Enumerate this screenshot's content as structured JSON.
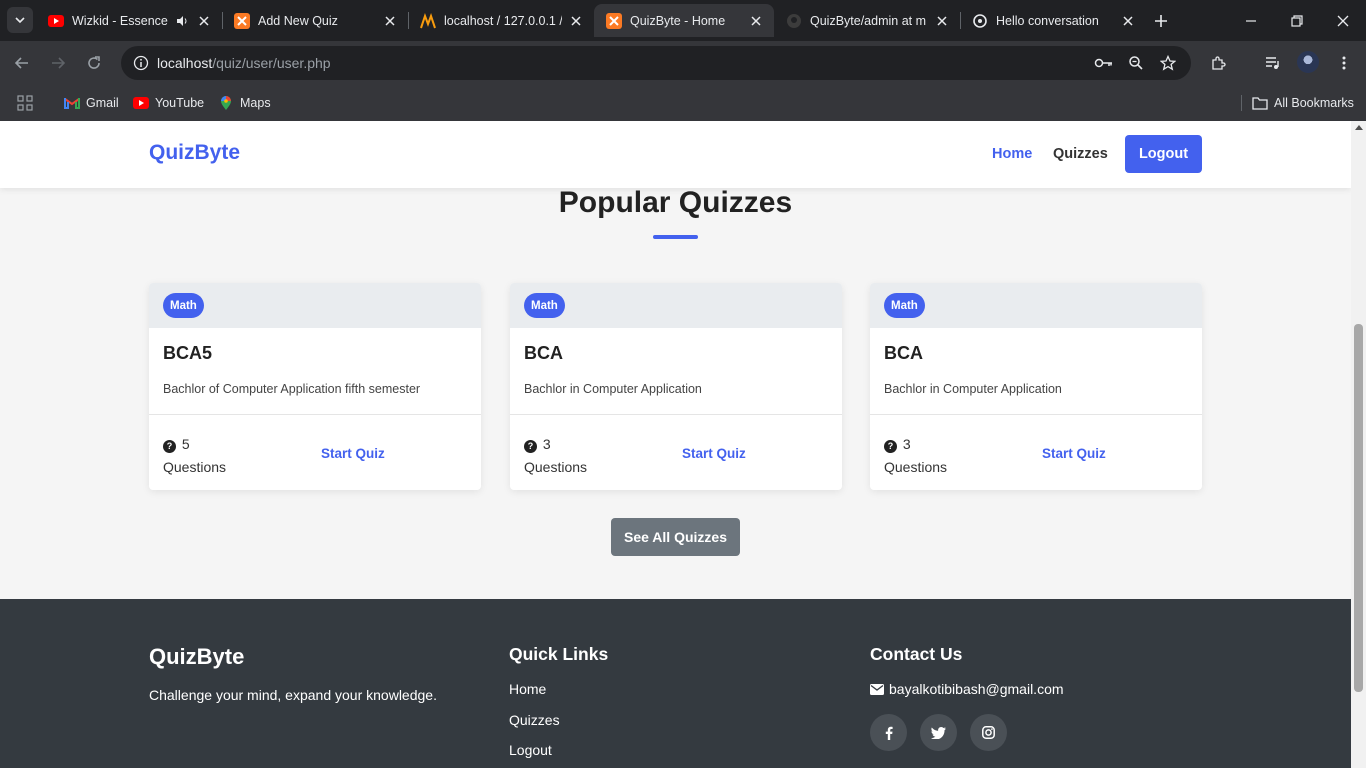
{
  "browser": {
    "tabs": [
      {
        "title": "Wizkid - Essence (",
        "favicon": "youtube-icon",
        "audio": true
      },
      {
        "title": "Add New Quiz",
        "favicon": "xampp-icon"
      },
      {
        "title": "localhost / 127.0.0.1 /",
        "favicon": "phpmyadmin-icon"
      },
      {
        "title": "QuizByte - Home",
        "favicon": "xampp-icon",
        "active": true
      },
      {
        "title": "QuizByte/admin at m",
        "favicon": "github-icon"
      },
      {
        "title": "Hello conversation",
        "favicon": "chatgpt-icon"
      }
    ],
    "address": {
      "host": "localhost",
      "path": "/quiz/user/user.php"
    },
    "bookmarks": [
      {
        "label": "Gmail",
        "icon": "gmail-icon"
      },
      {
        "label": "YouTube",
        "icon": "youtube-icon"
      },
      {
        "label": "Maps",
        "icon": "maps-icon"
      }
    ],
    "all_bookmarks": "All Bookmarks"
  },
  "navbar": {
    "brand": "QuizByte",
    "links": [
      "Home",
      "Quizzes"
    ],
    "logout": "Logout"
  },
  "section": {
    "title": "Popular Quizzes",
    "accent_color": "#4361ee"
  },
  "quizzes": [
    {
      "category": "Math",
      "title": "BCA5",
      "description": "Bachlor of Computer Application fifth semester",
      "count": "5",
      "questions_label": "Questions",
      "action": "Start Quiz"
    },
    {
      "category": "Math",
      "title": "BCA",
      "description": "Bachlor in Computer Application",
      "count": "3",
      "questions_label": "Questions",
      "action": "Start Quiz"
    },
    {
      "category": "Math",
      "title": "BCA",
      "description": "Bachlor in Computer Application",
      "count": "3",
      "questions_label": "Questions",
      "action": "Start Quiz"
    }
  ],
  "see_all": "See All Quizzes",
  "footer": {
    "brand": "QuizByte",
    "tagline": "Challenge your mind, expand your knowledge.",
    "quick_links_title": "Quick Links",
    "quick_links": [
      "Home",
      "Quizzes",
      "Logout"
    ],
    "contact_title": "Contact Us",
    "email": "bayalkotibibash@gmail.com",
    "socials": [
      "facebook-icon",
      "twitter-icon",
      "instagram-icon"
    ]
  }
}
